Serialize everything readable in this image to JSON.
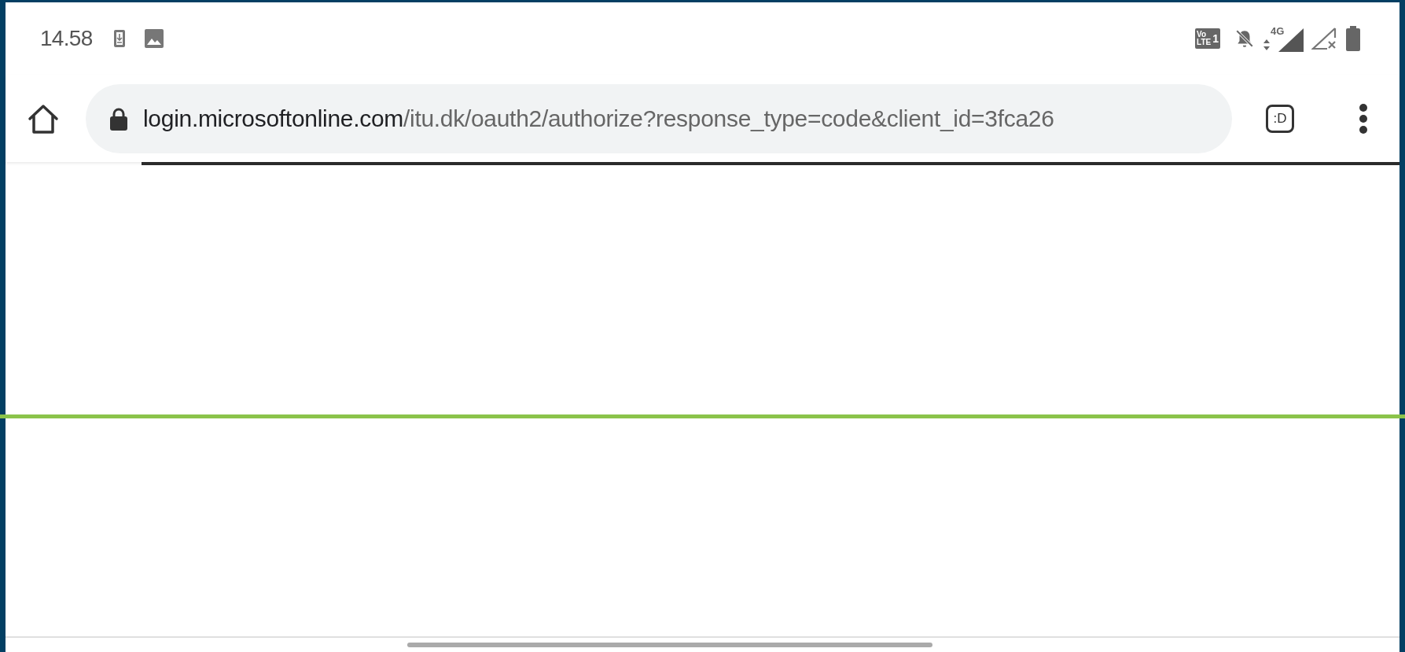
{
  "status_bar": {
    "time": "14.58",
    "volte": {
      "top": "Vo",
      "bottom": "LTE",
      "sim": "1"
    },
    "network": "4G"
  },
  "address_bar": {
    "domain": "login.microsoftonline.com",
    "path": "/itu.dk/oauth2/authorize?response_type=code&client_id=3fca26",
    "tab_switcher": ":D"
  }
}
